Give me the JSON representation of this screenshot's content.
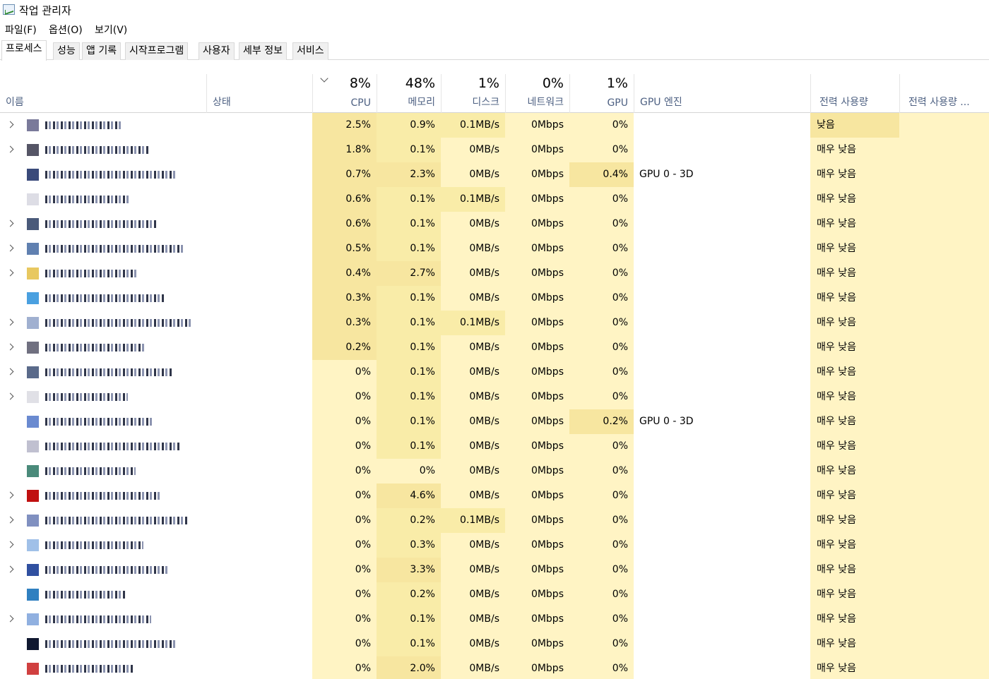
{
  "window": {
    "title": "작업 관리자"
  },
  "menu": [
    "파일(F)",
    "옵션(O)",
    "보기(V)"
  ],
  "tabs": [
    "프로세스",
    "성능",
    "앱 기록",
    "시작프로그램",
    "사용자",
    "세부 정보",
    "서비스"
  ],
  "active_tab": 0,
  "columns": {
    "name": "이름",
    "status": "상태",
    "cpu": {
      "pct": "8%",
      "label": "CPU"
    },
    "memory": {
      "pct": "48%",
      "label": "메모리"
    },
    "disk": {
      "pct": "1%",
      "label": "디스크"
    },
    "network": {
      "pct": "0%",
      "label": "네트워크"
    },
    "gpu": {
      "pct": "1%",
      "label": "GPU"
    },
    "gpu_engine": "GPU 엔진",
    "power": "전력 사용량",
    "power_trend": "전력 사용량 ..."
  },
  "colors": {
    "heat_light": "#fff4c4",
    "heat_medium": "#f9eca8",
    "heat_strong": "#f7e6a0",
    "header_label": "#4d6082"
  },
  "rows": [
    {
      "expand": true,
      "icon": "#7a7a9a",
      "cpu": "2.5%",
      "mem": "0.9%",
      "disk": "0.1MB/s",
      "net": "0Mbps",
      "gpu": "0%",
      "gpu_engine": "",
      "power": "낮음",
      "cpu_h": 2,
      "mem_h": 1,
      "disk_h": 1,
      "gpu_h": 0,
      "power_h": 2
    },
    {
      "expand": true,
      "icon": "#555566",
      "cpu": "1.8%",
      "mem": "0.1%",
      "disk": "0MB/s",
      "net": "0Mbps",
      "gpu": "0%",
      "gpu_engine": "",
      "power": "매우 낮음",
      "cpu_h": 2,
      "mem_h": 1,
      "disk_h": 0,
      "gpu_h": 0,
      "power_h": 0
    },
    {
      "expand": false,
      "icon": "#3a4a7a",
      "cpu": "0.7%",
      "mem": "2.3%",
      "disk": "0MB/s",
      "net": "0Mbps",
      "gpu": "0.4%",
      "gpu_engine": "GPU 0 - 3D",
      "power": "매우 낮음",
      "cpu_h": 2,
      "mem_h": 2,
      "disk_h": 0,
      "gpu_h": 2,
      "power_h": 0
    },
    {
      "expand": false,
      "icon": "#dddde5",
      "cpu": "0.6%",
      "mem": "0.1%",
      "disk": "0.1MB/s",
      "net": "0Mbps",
      "gpu": "0%",
      "gpu_engine": "",
      "power": "매우 낮음",
      "cpu_h": 2,
      "mem_h": 1,
      "disk_h": 1,
      "gpu_h": 0,
      "power_h": 0
    },
    {
      "expand": true,
      "icon": "#4a5a7a",
      "cpu": "0.6%",
      "mem": "0.1%",
      "disk": "0MB/s",
      "net": "0Mbps",
      "gpu": "0%",
      "gpu_engine": "",
      "power": "매우 낮음",
      "cpu_h": 2,
      "mem_h": 1,
      "disk_h": 0,
      "gpu_h": 0,
      "power_h": 0
    },
    {
      "expand": true,
      "icon": "#6080b0",
      "cpu": "0.5%",
      "mem": "0.1%",
      "disk": "0MB/s",
      "net": "0Mbps",
      "gpu": "0%",
      "gpu_engine": "",
      "power": "매우 낮음",
      "cpu_h": 2,
      "mem_h": 1,
      "disk_h": 0,
      "gpu_h": 0,
      "power_h": 0
    },
    {
      "expand": true,
      "icon": "#e8c860",
      "cpu": "0.4%",
      "mem": "2.7%",
      "disk": "0MB/s",
      "net": "0Mbps",
      "gpu": "0%",
      "gpu_engine": "",
      "power": "매우 낮음",
      "cpu_h": 2,
      "mem_h": 2,
      "disk_h": 0,
      "gpu_h": 0,
      "power_h": 0
    },
    {
      "expand": false,
      "icon": "#4aa0e0",
      "cpu": "0.3%",
      "mem": "0.1%",
      "disk": "0MB/s",
      "net": "0Mbps",
      "gpu": "0%",
      "gpu_engine": "",
      "power": "매우 낮음",
      "cpu_h": 2,
      "mem_h": 1,
      "disk_h": 0,
      "gpu_h": 0,
      "power_h": 0
    },
    {
      "expand": true,
      "icon": "#a0b0d0",
      "cpu": "0.3%",
      "mem": "0.1%",
      "disk": "0.1MB/s",
      "net": "0Mbps",
      "gpu": "0%",
      "gpu_engine": "",
      "power": "매우 낮음",
      "cpu_h": 2,
      "mem_h": 1,
      "disk_h": 1,
      "gpu_h": 0,
      "power_h": 0
    },
    {
      "expand": true,
      "icon": "#707080",
      "cpu": "0.2%",
      "mem": "0.1%",
      "disk": "0MB/s",
      "net": "0Mbps",
      "gpu": "0%",
      "gpu_engine": "",
      "power": "매우 낮음",
      "cpu_h": 2,
      "mem_h": 1,
      "disk_h": 0,
      "gpu_h": 0,
      "power_h": 0
    },
    {
      "expand": true,
      "icon": "#5a6a8a",
      "cpu": "0%",
      "mem": "0.1%",
      "disk": "0MB/s",
      "net": "0Mbps",
      "gpu": "0%",
      "gpu_engine": "",
      "power": "매우 낮음",
      "cpu_h": 0,
      "mem_h": 1,
      "disk_h": 0,
      "gpu_h": 0,
      "power_h": 0
    },
    {
      "expand": true,
      "icon": "#e0e0e6",
      "cpu": "0%",
      "mem": "0.1%",
      "disk": "0MB/s",
      "net": "0Mbps",
      "gpu": "0%",
      "gpu_engine": "",
      "power": "매우 낮음",
      "cpu_h": 0,
      "mem_h": 1,
      "disk_h": 0,
      "gpu_h": 0,
      "power_h": 0
    },
    {
      "expand": false,
      "icon": "#6a8ad0",
      "cpu": "0%",
      "mem": "0.1%",
      "disk": "0MB/s",
      "net": "0Mbps",
      "gpu": "0.2%",
      "gpu_engine": "GPU 0 - 3D",
      "power": "매우 낮음",
      "cpu_h": 0,
      "mem_h": 1,
      "disk_h": 0,
      "gpu_h": 2,
      "power_h": 0
    },
    {
      "expand": false,
      "icon": "#c0c0d0",
      "cpu": "0%",
      "mem": "0.1%",
      "disk": "0MB/s",
      "net": "0Mbps",
      "gpu": "0%",
      "gpu_engine": "",
      "power": "매우 낮음",
      "cpu_h": 0,
      "mem_h": 1,
      "disk_h": 0,
      "gpu_h": 0,
      "power_h": 0
    },
    {
      "expand": false,
      "icon": "#4a8a7a",
      "cpu": "0%",
      "mem": "0%",
      "disk": "0MB/s",
      "net": "0Mbps",
      "gpu": "0%",
      "gpu_engine": "",
      "power": "매우 낮음",
      "cpu_h": 0,
      "mem_h": 0,
      "disk_h": 0,
      "gpu_h": 0,
      "power_h": 0
    },
    {
      "expand": true,
      "icon": "#c01010",
      "cpu": "0%",
      "mem": "4.6%",
      "disk": "0MB/s",
      "net": "0Mbps",
      "gpu": "0%",
      "gpu_engine": "",
      "power": "매우 낮음",
      "cpu_h": 0,
      "mem_h": 2,
      "disk_h": 0,
      "gpu_h": 0,
      "power_h": 0
    },
    {
      "expand": true,
      "icon": "#8090c0",
      "cpu": "0%",
      "mem": "0.2%",
      "disk": "0.1MB/s",
      "net": "0Mbps",
      "gpu": "0%",
      "gpu_engine": "",
      "power": "매우 낮음",
      "cpu_h": 0,
      "mem_h": 1,
      "disk_h": 1,
      "gpu_h": 0,
      "power_h": 0
    },
    {
      "expand": true,
      "icon": "#a0c0e8",
      "cpu": "0%",
      "mem": "0.3%",
      "disk": "0MB/s",
      "net": "0Mbps",
      "gpu": "0%",
      "gpu_engine": "",
      "power": "매우 낮음",
      "cpu_h": 0,
      "mem_h": 1,
      "disk_h": 0,
      "gpu_h": 0,
      "power_h": 0
    },
    {
      "expand": true,
      "icon": "#3050a0",
      "cpu": "0%",
      "mem": "3.3%",
      "disk": "0MB/s",
      "net": "0Mbps",
      "gpu": "0%",
      "gpu_engine": "",
      "power": "매우 낮음",
      "cpu_h": 0,
      "mem_h": 2,
      "disk_h": 0,
      "gpu_h": 0,
      "power_h": 0
    },
    {
      "expand": false,
      "icon": "#3080c0",
      "cpu": "0%",
      "mem": "0.2%",
      "disk": "0MB/s",
      "net": "0Mbps",
      "gpu": "0%",
      "gpu_engine": "",
      "power": "매우 낮음",
      "cpu_h": 0,
      "mem_h": 1,
      "disk_h": 0,
      "gpu_h": 0,
      "power_h": 0
    },
    {
      "expand": true,
      "icon": "#90b0e0",
      "cpu": "0%",
      "mem": "0.1%",
      "disk": "0MB/s",
      "net": "0Mbps",
      "gpu": "0%",
      "gpu_engine": "",
      "power": "매우 낮음",
      "cpu_h": 0,
      "mem_h": 1,
      "disk_h": 0,
      "gpu_h": 0,
      "power_h": 0
    },
    {
      "expand": false,
      "icon": "#101830",
      "cpu": "0%",
      "mem": "0.1%",
      "disk": "0MB/s",
      "net": "0Mbps",
      "gpu": "0%",
      "gpu_engine": "",
      "power": "매우 낮음",
      "cpu_h": 0,
      "mem_h": 1,
      "disk_h": 0,
      "gpu_h": 0,
      "power_h": 0
    },
    {
      "expand": false,
      "icon": "#d04040",
      "cpu": "0%",
      "mem": "2.0%",
      "disk": "0MB/s",
      "net": "0Mbps",
      "gpu": "0%",
      "gpu_engine": "",
      "power": "매우 낮음",
      "cpu_h": 0,
      "mem_h": 2,
      "disk_h": 0,
      "gpu_h": 0,
      "power_h": 0
    }
  ]
}
